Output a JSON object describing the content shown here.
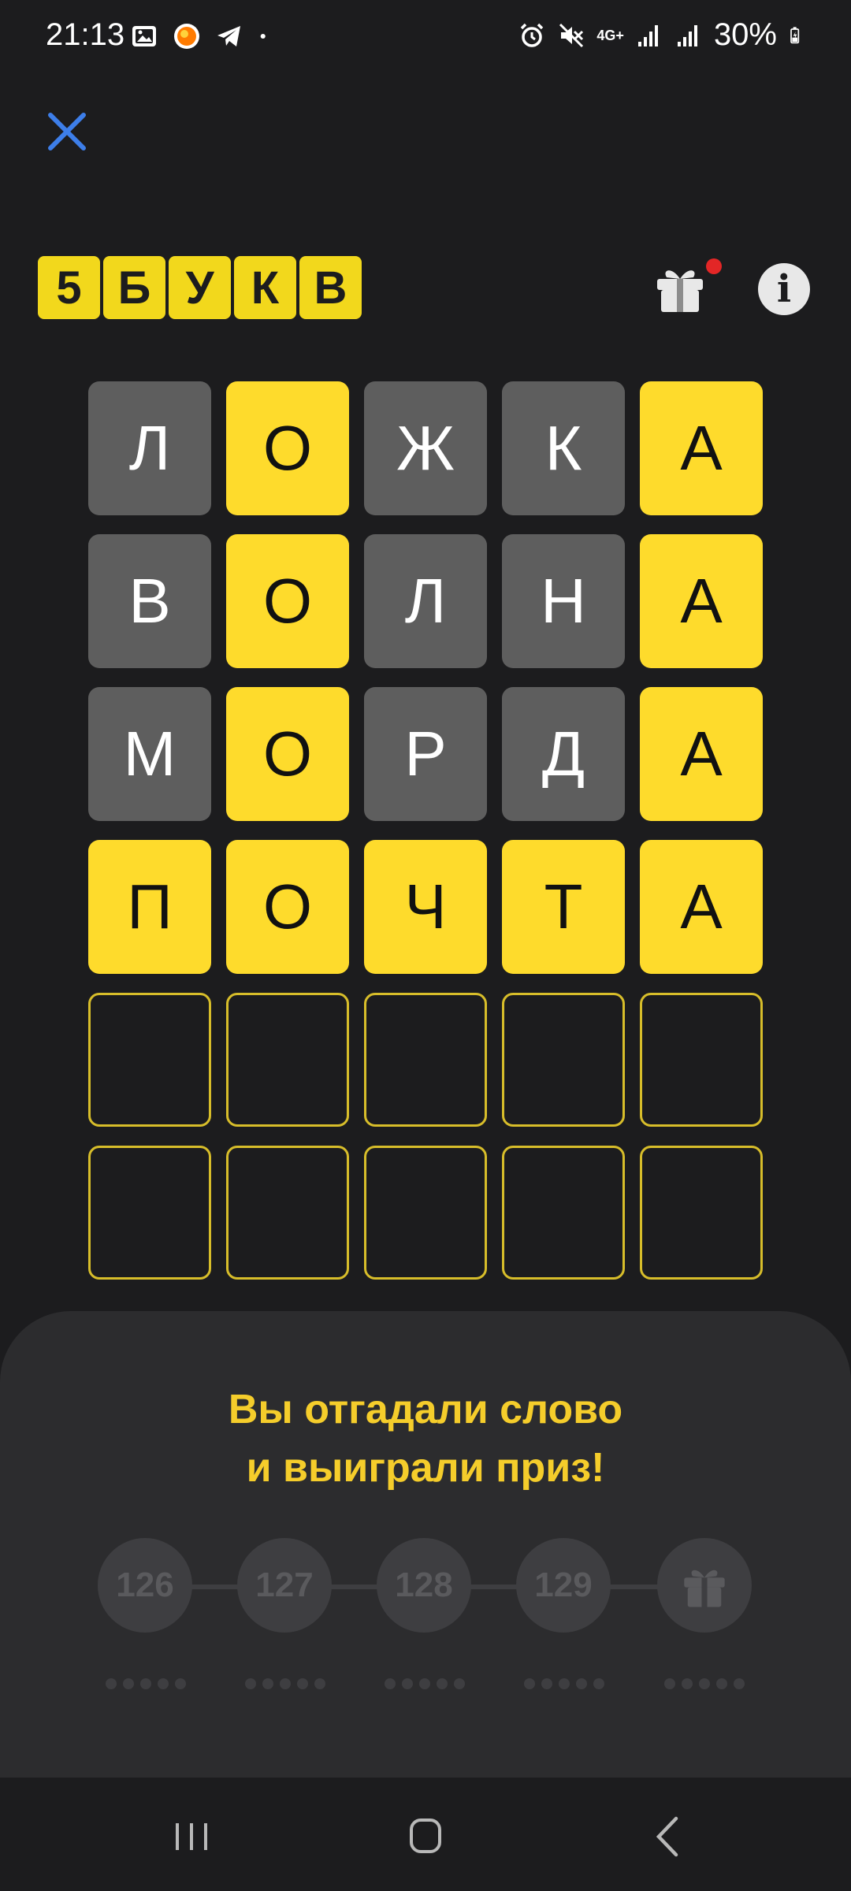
{
  "status": {
    "time": "21:13",
    "network": "4G+",
    "battery": "30%"
  },
  "logo": {
    "tiles": [
      "5",
      "Б",
      "У",
      "К",
      "В"
    ]
  },
  "grid": {
    "rows": [
      [
        {
          "l": "Л",
          "s": "gray"
        },
        {
          "l": "О",
          "s": "yellow"
        },
        {
          "l": "Ж",
          "s": "gray"
        },
        {
          "l": "К",
          "s": "gray"
        },
        {
          "l": "А",
          "s": "yellow"
        }
      ],
      [
        {
          "l": "В",
          "s": "gray"
        },
        {
          "l": "О",
          "s": "yellow"
        },
        {
          "l": "Л",
          "s": "gray"
        },
        {
          "l": "Н",
          "s": "gray"
        },
        {
          "l": "А",
          "s": "yellow"
        }
      ],
      [
        {
          "l": "М",
          "s": "gray"
        },
        {
          "l": "О",
          "s": "yellow"
        },
        {
          "l": "Р",
          "s": "gray"
        },
        {
          "l": "Д",
          "s": "gray"
        },
        {
          "l": "А",
          "s": "yellow"
        }
      ],
      [
        {
          "l": "П",
          "s": "yellow"
        },
        {
          "l": "О",
          "s": "yellow"
        },
        {
          "l": "Ч",
          "s": "yellow"
        },
        {
          "l": "Т",
          "s": "yellow"
        },
        {
          "l": "А",
          "s": "yellow"
        }
      ],
      [
        {
          "l": "",
          "s": "empty"
        },
        {
          "l": "",
          "s": "empty"
        },
        {
          "l": "",
          "s": "empty"
        },
        {
          "l": "",
          "s": "empty"
        },
        {
          "l": "",
          "s": "empty"
        }
      ],
      [
        {
          "l": "",
          "s": "empty"
        },
        {
          "l": "",
          "s": "empty"
        },
        {
          "l": "",
          "s": "empty"
        },
        {
          "l": "",
          "s": "empty"
        },
        {
          "l": "",
          "s": "empty"
        }
      ]
    ]
  },
  "sheet": {
    "title_line1": "Вы отгадали слово",
    "title_line2": "и выиграли приз!",
    "steps": [
      "126",
      "127",
      "128",
      "129"
    ],
    "final_step_icon": "gift-icon"
  },
  "colors": {
    "background": "#1c1c1e",
    "tile_yellow": "#fedb2c",
    "tile_gray": "#5e5e5e",
    "accent_text": "#f5cd2b",
    "close_blue": "#3d7ee9"
  }
}
